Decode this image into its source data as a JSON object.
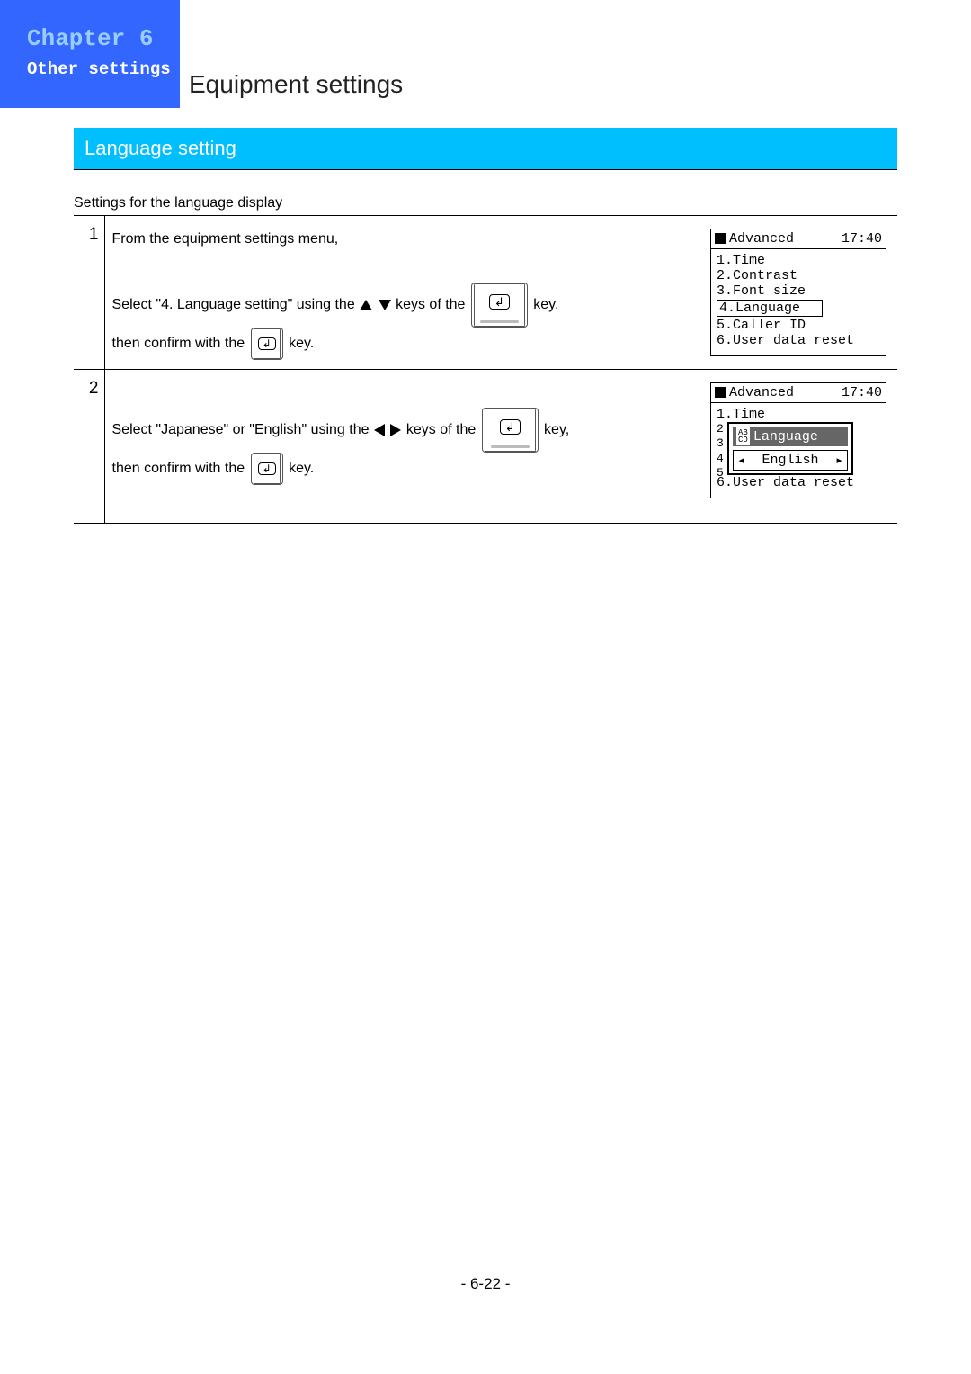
{
  "chapter": {
    "label": "Chapter",
    "num": "6",
    "subtitle": "Other settings"
  },
  "title": "Equipment settings",
  "section": "Language setting",
  "intro": "Settings for the language display",
  "step1": {
    "num": "1",
    "t1": "From the equipment settings menu,",
    "t2a": "Select \"4. Language setting\" using the ",
    "t2b": " keys of the ",
    "t2c": " key,",
    "t3a": "then confirm with the ",
    "t3b": " key.",
    "screen": {
      "title": "Advanced",
      "time": "17:40",
      "items": [
        "1.Time",
        "2.Contrast",
        "3.Font size",
        "4.Language",
        "5.Caller ID",
        "6.User data reset"
      ],
      "highlightIndex": 3
    }
  },
  "step2": {
    "num": "2",
    "t1a": "Select \"Japanese\" or \"English\" using the ",
    "t1b": " keys of the ",
    "t1c": " key,",
    "t2a": "then confirm with the ",
    "t2b": " key.",
    "screen": {
      "title": "Advanced",
      "time": "17:40",
      "topItem": "1.Time",
      "popupTitle": "Language",
      "popupValue": "English",
      "bottomItem": "6.User data reset"
    }
  },
  "page": "- 6-22 -"
}
